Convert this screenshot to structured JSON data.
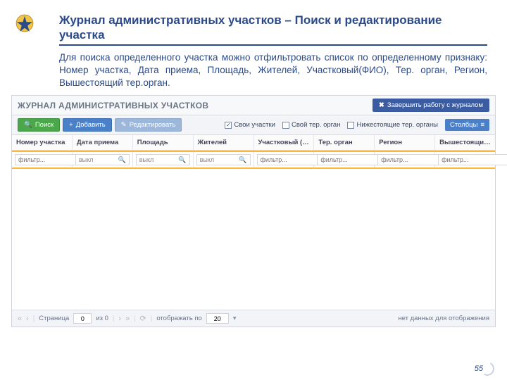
{
  "slide": {
    "heading": "Журнал административных участков – Поиск и редактирование участка",
    "description": "Для поиска определенного участка можно отфильтровать список по определенному признаку: Номер участка, Дата приема, Площадь, Жителей, Участковый(ФИО), Тер. орган, Регион, Вышестоящий тер.орган.",
    "page_number": "55"
  },
  "app": {
    "title": "ЖУРНАЛ АДМИНИСТРАТИВНЫХ УЧАСТКОВ",
    "close_btn": "Завершить работу с журналом",
    "toolbar": {
      "search": "Поиск",
      "add": "Добавить",
      "edit": "Редактировать",
      "filters": {
        "own": "Свои участки",
        "own_org": "Свой тер. орган",
        "lower_org": "Нижестоящие тер. органы"
      },
      "columns_btn": "Столбцы"
    },
    "columns": [
      "Номер участка",
      "Дата приема",
      "Площадь",
      "Жителей",
      "Участковый (ФИО)",
      "Тер. орган",
      "Регион",
      "Вышестоящий тер."
    ],
    "filter": {
      "text_placeholder": "фильтр...",
      "toggle_off": "выкл"
    },
    "footer": {
      "page_label": "Страница",
      "page_current": "0",
      "page_of": "из 0",
      "per_page_label": "отображать по",
      "per_page_value": "20",
      "status": "нет данных для отображения"
    }
  }
}
